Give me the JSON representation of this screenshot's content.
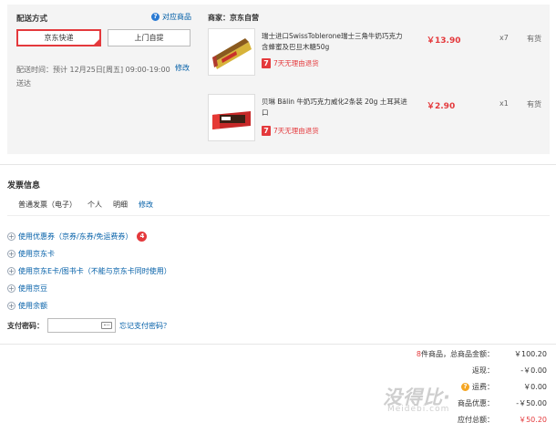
{
  "shipping": {
    "title": "配送方式",
    "match_link": "对应商品",
    "options": [
      "京东快递",
      "上门自提"
    ],
    "time_label": "配送时间：",
    "time_value": "预计 12月25日[周五] 09:00-19:00 送达",
    "edit": "修改"
  },
  "seller": "商家：京东自营",
  "products": [
    {
      "name": "瑞士进口SwissToblerone瑞士三角牛奶巧克力含蜂蜜及巴旦木糖50g",
      "return_policy": "7天无理由退货",
      "return_badge": "7",
      "price": "￥13.90",
      "qty": "x7",
      "stock": "有货"
    },
    {
      "name": "贝琳 Bälin 牛奶巧克力威化2条装 20g 土耳其进口",
      "return_policy": "7天无理由退货",
      "return_badge": "7",
      "price": "￥2.90",
      "qty": "x1",
      "stock": "有货"
    }
  ],
  "invoice": {
    "title": "发票信息",
    "type": "普通发票（电子）",
    "owner": "个人",
    "content": "明细",
    "edit": "修改"
  },
  "options": [
    {
      "label": "使用优惠券（京券/东券/免运费券）",
      "badge": "4"
    },
    {
      "label": "使用京东卡"
    },
    {
      "label": "使用京东E卡/图书卡（不能与京东卡同时使用）"
    },
    {
      "label": "使用京豆"
    },
    {
      "label": "使用余额"
    }
  ],
  "payment": {
    "label": "支付密码：",
    "forgot": "忘记支付密码？"
  },
  "summary": {
    "count": "8",
    "count_text": "件商品，总商品金额：",
    "total": "￥100.20",
    "rebate_label": "返现：",
    "rebate": "-￥0.00",
    "shipping_label": "运费：",
    "shipping": "￥0.00",
    "discount_label": "商品优惠：",
    "discount": "-￥50.00",
    "due_label": "应付总额：",
    "due": "￥50.20"
  },
  "watermark": {
    "main": "没得比·",
    "sub": "Meidebi.com"
  },
  "colors": {
    "accent": "#e4393c",
    "link": "#005ea7",
    "panel": "#f4f4f4"
  }
}
